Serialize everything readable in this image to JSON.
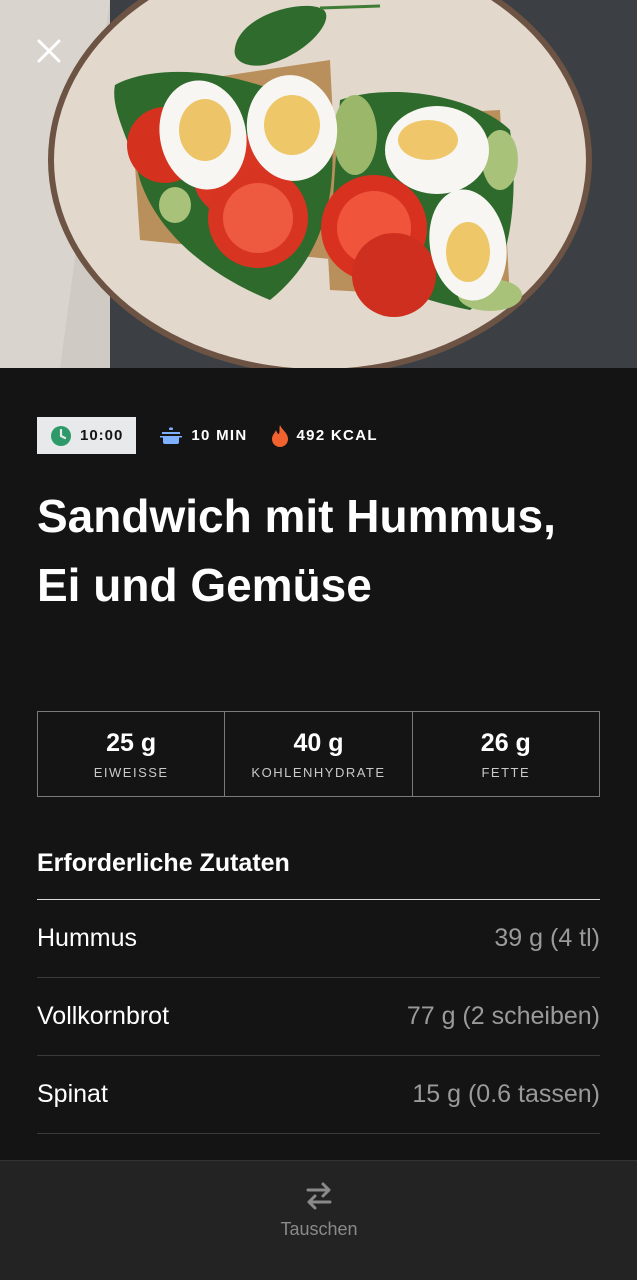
{
  "hero": {
    "image": "sandwich-with-egg-tomato-spinach-photo",
    "close_icon": "close-icon"
  },
  "meta": {
    "time": "10:00",
    "duration": "10 MIN",
    "calories": "492 KCAL"
  },
  "title": "Sandwich mit Hummus, Ei und Gemüse",
  "macros": [
    {
      "value": "25 g",
      "label": "EIWEISSE"
    },
    {
      "value": "40 g",
      "label": "KOHLENHYDRATE"
    },
    {
      "value": "26 g",
      "label": "FETTE"
    }
  ],
  "ingredients_heading": "Erforderliche Zutaten",
  "ingredients": [
    {
      "name": "Hummus",
      "amount": "39 g (4 tl)"
    },
    {
      "name": "Vollkornbrot",
      "amount": "77 g (2 scheiben)"
    },
    {
      "name": "Spinat",
      "amount": "15 g (0.6 tassen)"
    }
  ],
  "bottom": {
    "swap_label": "Tauschen"
  },
  "colors": {
    "background": "#141414",
    "chip": "#e8e9ea",
    "clock": "#2e9a6a",
    "pot": "#7fb0ff",
    "flame": "#f2622e"
  }
}
